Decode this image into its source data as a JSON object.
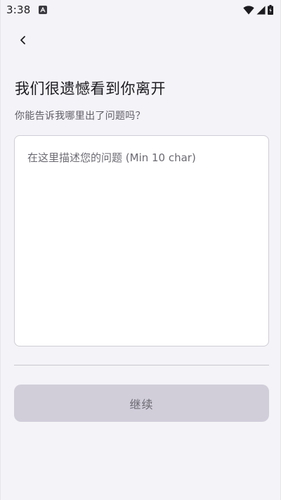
{
  "status_bar": {
    "time": "3:38",
    "app_icon": "a-app-icon",
    "icons": [
      "wifi-icon",
      "signal-icon",
      "battery-charging-icon"
    ]
  },
  "nav": {
    "back_icon": "chevron-left-icon"
  },
  "page": {
    "title": "我们很遗憾看到你离开",
    "subtitle": "你能告诉我哪里出了问题吗？"
  },
  "form": {
    "problem_value": "",
    "problem_placeholder": "在这里描述您的问题 (Min 10 char)"
  },
  "actions": {
    "continue_label": "继续"
  }
}
